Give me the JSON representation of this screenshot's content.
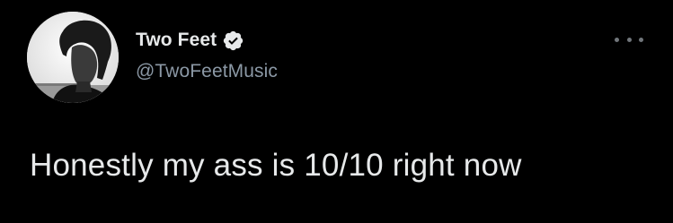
{
  "tweet": {
    "author": {
      "display_name": "Two Feet",
      "handle": "@TwoFeetMusic",
      "verified": true,
      "avatar_icon": "profile-photo"
    },
    "text": "Honestly my ass is 10/10 right now",
    "more_icon": "more-options-icon"
  },
  "colors": {
    "background": "#000000",
    "primary_text": "#e7e9ea",
    "secondary_text": "#8b98a5",
    "verified_badge": "#e7e9ea"
  }
}
